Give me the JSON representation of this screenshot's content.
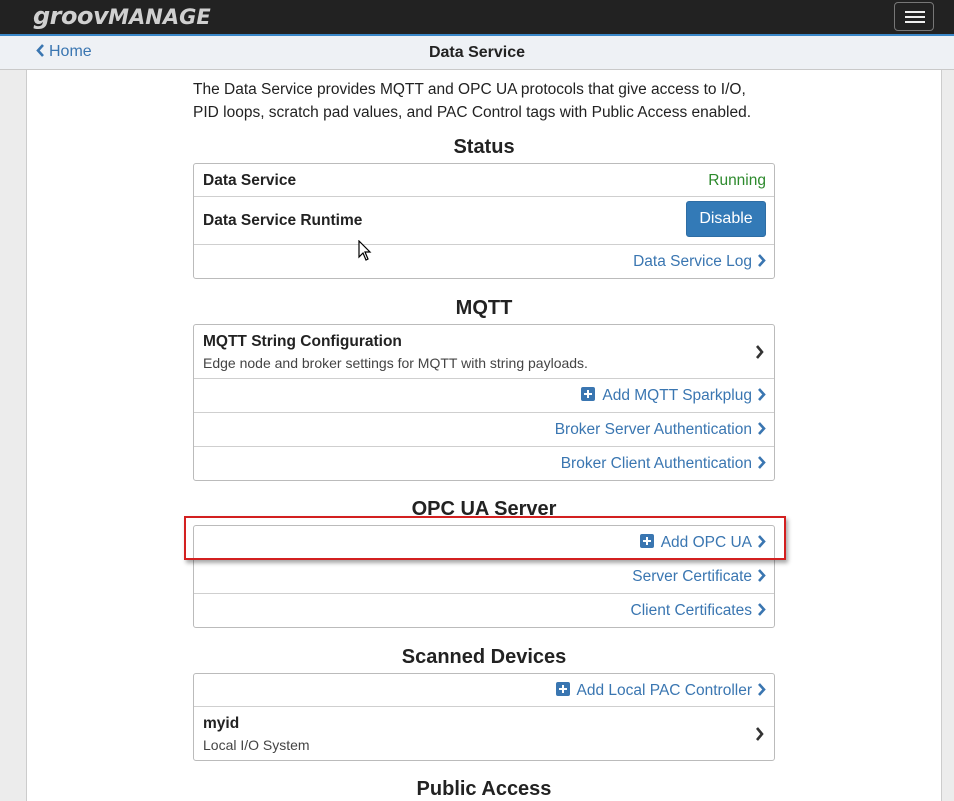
{
  "navbar": {
    "logo_part1": "groov",
    "logo_part2": "MANAGE",
    "menu_icon": "hamburger-menu-icon"
  },
  "subheader": {
    "back_label": "Home",
    "title": "Data Service"
  },
  "description": "The Data Service provides MQTT and OPC UA protocols that give access to I/O, PID loops, scratch pad values, and PAC Control tags with Public Access enabled.",
  "status": {
    "title": "Status",
    "data_service_label": "Data Service",
    "data_service_value": "Running",
    "runtime_label": "Data Service Runtime",
    "disable_label": "Disable",
    "log_link": "Data Service Log"
  },
  "mqtt": {
    "title": "MQTT",
    "string_config_label": "MQTT String Configuration",
    "string_config_sub": "Edge node and broker settings for MQTT with string payloads.",
    "add_sparkplug": "Add MQTT Sparkplug",
    "broker_server_auth": "Broker Server Authentication",
    "broker_client_auth": "Broker Client Authentication"
  },
  "opcua": {
    "title": "OPC UA Server",
    "add_opcua": "Add OPC UA",
    "server_cert": "Server Certificate",
    "client_certs": "Client Certificates"
  },
  "scanned": {
    "title": "Scanned Devices",
    "add_local_pac": "Add Local PAC Controller",
    "device_name": "myid",
    "device_sub": "Local I/O System"
  },
  "public_access": {
    "title": "Public Access"
  },
  "colors": {
    "accent": "#3a76b1",
    "running": "#2d8a2d",
    "button": "#337ab7",
    "highlight": "#d32020"
  }
}
